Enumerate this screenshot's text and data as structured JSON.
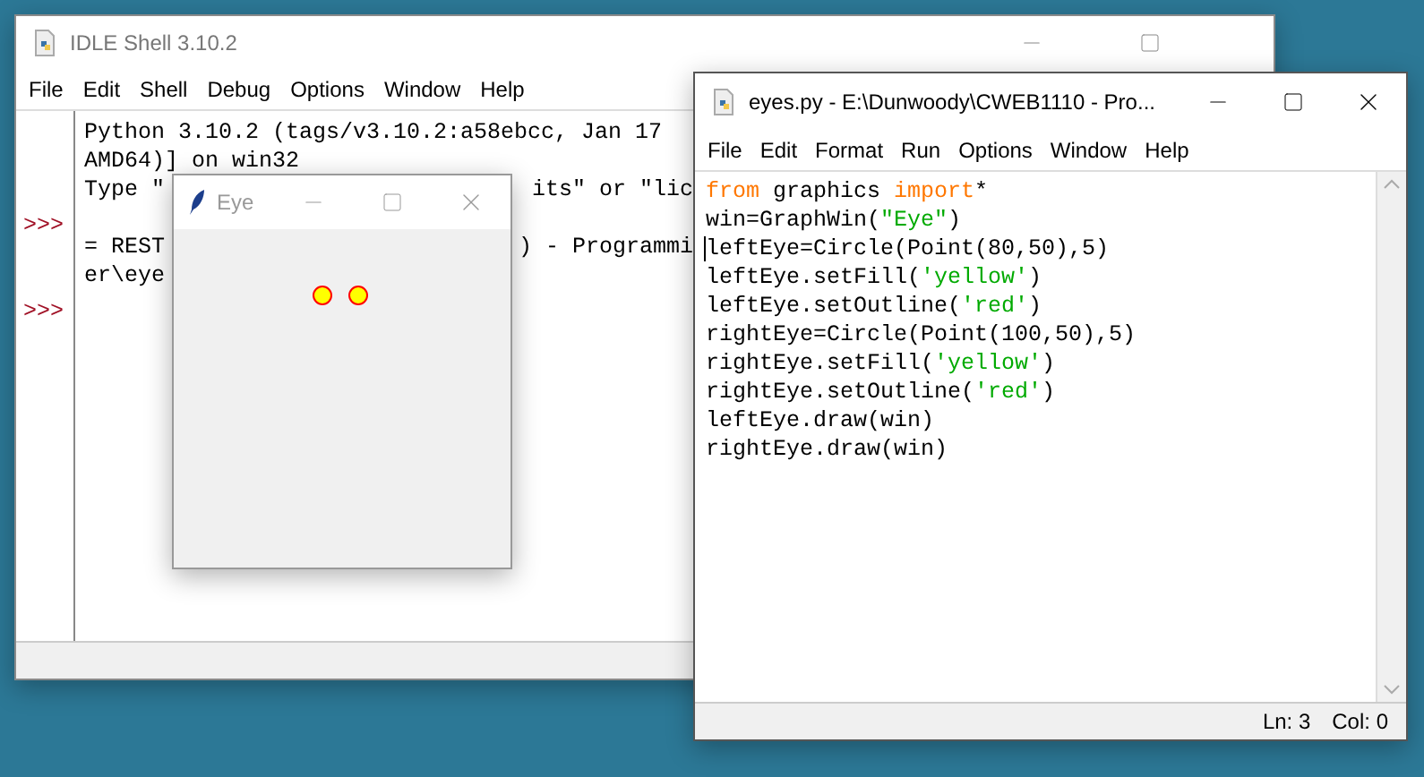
{
  "shell_window": {
    "title": "IDLE Shell 3.10.2",
    "menu": [
      "File",
      "Edit",
      "Shell",
      "Debug",
      "Options",
      "Window",
      "Help"
    ],
    "lines": [
      {
        "segments": [
          "Python 3.10.2 (tags/v3.10.2:a58ebcc, Jan 17"
        ]
      },
      {
        "segments": [
          "AMD64)] on win32"
        ]
      },
      {
        "segments": [
          "Type \"",
          "its\" or \"lic"
        ]
      },
      {
        "prompt": ">>>"
      },
      {
        "segments": [
          "= REST",
          ") - Programmi"
        ]
      },
      {
        "segments": [
          "er\\eye"
        ]
      },
      {
        "prompt": ">>>"
      }
    ]
  },
  "eye_window": {
    "title": "Eye"
  },
  "editor_window": {
    "title": "eyes.py - E:\\Dunwoody\\CWEB1110 - Pro...",
    "menu": [
      "File",
      "Edit",
      "Format",
      "Run",
      "Options",
      "Window",
      "Help"
    ],
    "code": [
      {
        "cursor": false,
        "tokens": [
          {
            "kind": "keyword",
            "text": "from"
          },
          {
            "kind": "plain",
            "text": " graphics "
          },
          {
            "kind": "keyword",
            "text": "import"
          },
          {
            "kind": "plain",
            "text": "*"
          }
        ]
      },
      {
        "cursor": false,
        "tokens": [
          {
            "kind": "plain",
            "text": "win=GraphWin("
          },
          {
            "kind": "string",
            "text": "\"Eye\""
          },
          {
            "kind": "plain",
            "text": ")"
          }
        ]
      },
      {
        "cursor": true,
        "tokens": [
          {
            "kind": "plain",
            "text": "leftEye=Circle(Point(80,50),5)"
          }
        ]
      },
      {
        "cursor": false,
        "tokens": [
          {
            "kind": "plain",
            "text": "leftEye.setFill("
          },
          {
            "kind": "string",
            "text": "'yellow'"
          },
          {
            "kind": "plain",
            "text": ")"
          }
        ]
      },
      {
        "cursor": false,
        "tokens": [
          {
            "kind": "plain",
            "text": "leftEye.setOutline("
          },
          {
            "kind": "string",
            "text": "'red'"
          },
          {
            "kind": "plain",
            "text": ")"
          }
        ]
      },
      {
        "cursor": false,
        "tokens": [
          {
            "kind": "plain",
            "text": "rightEye=Circle(Point(100,50),5)"
          }
        ]
      },
      {
        "cursor": false,
        "tokens": [
          {
            "kind": "plain",
            "text": "rightEye.setFill("
          },
          {
            "kind": "string",
            "text": "'yellow'"
          },
          {
            "kind": "plain",
            "text": ")"
          }
        ]
      },
      {
        "cursor": false,
        "tokens": [
          {
            "kind": "plain",
            "text": "rightEye.setOutline("
          },
          {
            "kind": "string",
            "text": "'red'"
          },
          {
            "kind": "plain",
            "text": ")"
          }
        ]
      },
      {
        "cursor": false,
        "tokens": [
          {
            "kind": "plain",
            "text": "leftEye.draw(win)"
          }
        ]
      },
      {
        "cursor": false,
        "tokens": [
          {
            "kind": "plain",
            "text": "rightEye.draw(win)"
          }
        ]
      }
    ],
    "status": {
      "line": "Ln: 3",
      "column": "Col: 0"
    }
  }
}
